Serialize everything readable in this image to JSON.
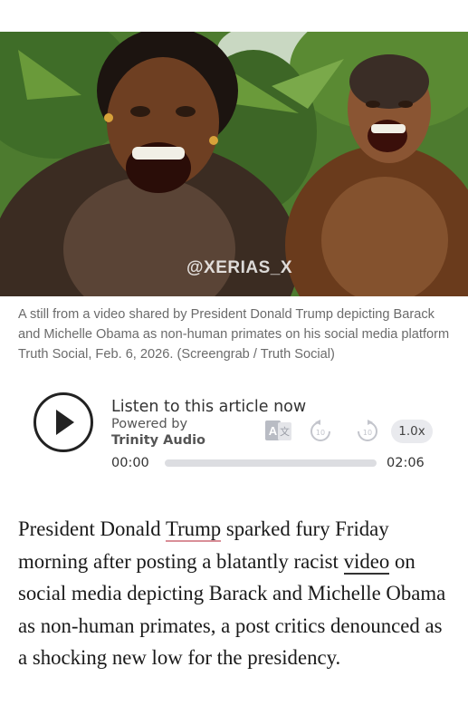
{
  "image": {
    "alt_icon": "photo-still",
    "watermark": "@XERIAS_X"
  },
  "caption": "A still from a video shared by President Donald Trump depicting Barack and Michelle Obama as non-human primates on his social media platform Truth Social, Feb. 6, 2026. (Screengrab / Truth Social)",
  "audio_player": {
    "title": "Listen to this article now",
    "powered_by": "Powered by",
    "provider": "Trinity Audio",
    "rewind_label": "10",
    "forward_label": "10",
    "speed": "1.0x",
    "current_time": "00:00",
    "total_time": "02:06",
    "progress": 0,
    "icons": [
      "play-icon",
      "translate-icon",
      "rewind-10-icon",
      "forward-10-icon"
    ]
  },
  "article": {
    "text_1": "President Donald ",
    "link_1": "Trump",
    "text_2": " sparked fury Friday morning after posting a blatantly racist ",
    "link_2": "video",
    "text_3": " on social media depicting Barack and Michelle Obama as non-human primates, a post critics denounced as a shocking new low for the presidency."
  },
  "colors": {
    "caption": "#6b6b6b",
    "link_underline": "#d98f98",
    "speed_pill": "#e9eaee"
  }
}
